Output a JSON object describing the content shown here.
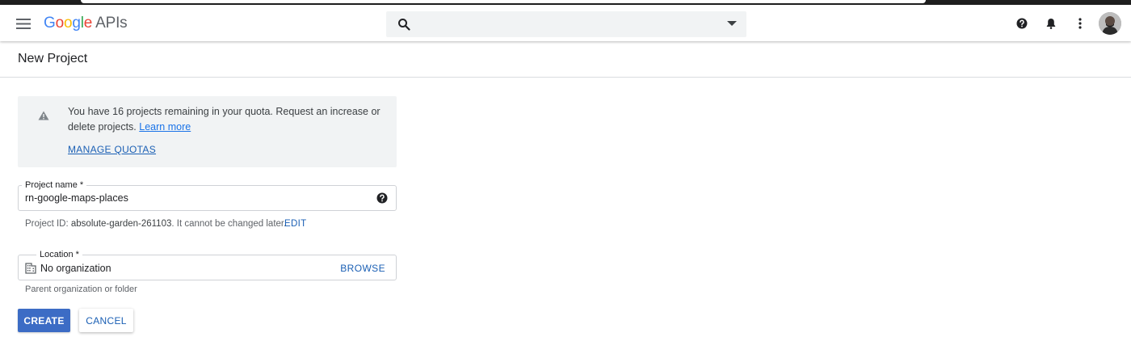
{
  "header": {
    "logo": {
      "g1": "G",
      "o1": "o",
      "o2": "o",
      "g2": "g",
      "l": "l",
      "e": "e",
      "suffix": "APIs"
    },
    "search": {
      "value": "",
      "placeholder": ""
    },
    "icons": [
      "menu-icon",
      "search-icon",
      "dropdown-arrow-icon",
      "help-icon",
      "bell-icon",
      "more-vert-icon",
      "avatar"
    ]
  },
  "page": {
    "title": "New Project"
  },
  "quota_notice": {
    "icon": "warning-icon",
    "text": "You have 16 projects remaining in your quota. Request an increase or delete projects.",
    "learn_more": "Learn more",
    "manage_quotas": "MANAGE QUOTAS"
  },
  "project_name": {
    "label": "Project name *",
    "value": "rn-google-maps-places",
    "help_icon": "help-icon"
  },
  "project_id": {
    "prefix": "Project ID:",
    "id": "absolute-garden-261103",
    "suffix": ". It cannot be changed later.",
    "edit": "EDIT"
  },
  "location": {
    "label": "Location *",
    "icon": "building-icon",
    "value": "No organization",
    "browse": "BROWSE",
    "help": "Parent organization or folder"
  },
  "actions": {
    "create": "CREATE",
    "cancel": "CANCEL"
  },
  "colors": {
    "primary_button": "#3c6cc5",
    "link": "#1a5fb4",
    "notice_bg": "#f1f3f4",
    "logo_blue": "#4285f4",
    "logo_red": "#ea4335",
    "logo_yellow": "#fbbc05",
    "logo_green": "#34a853"
  }
}
